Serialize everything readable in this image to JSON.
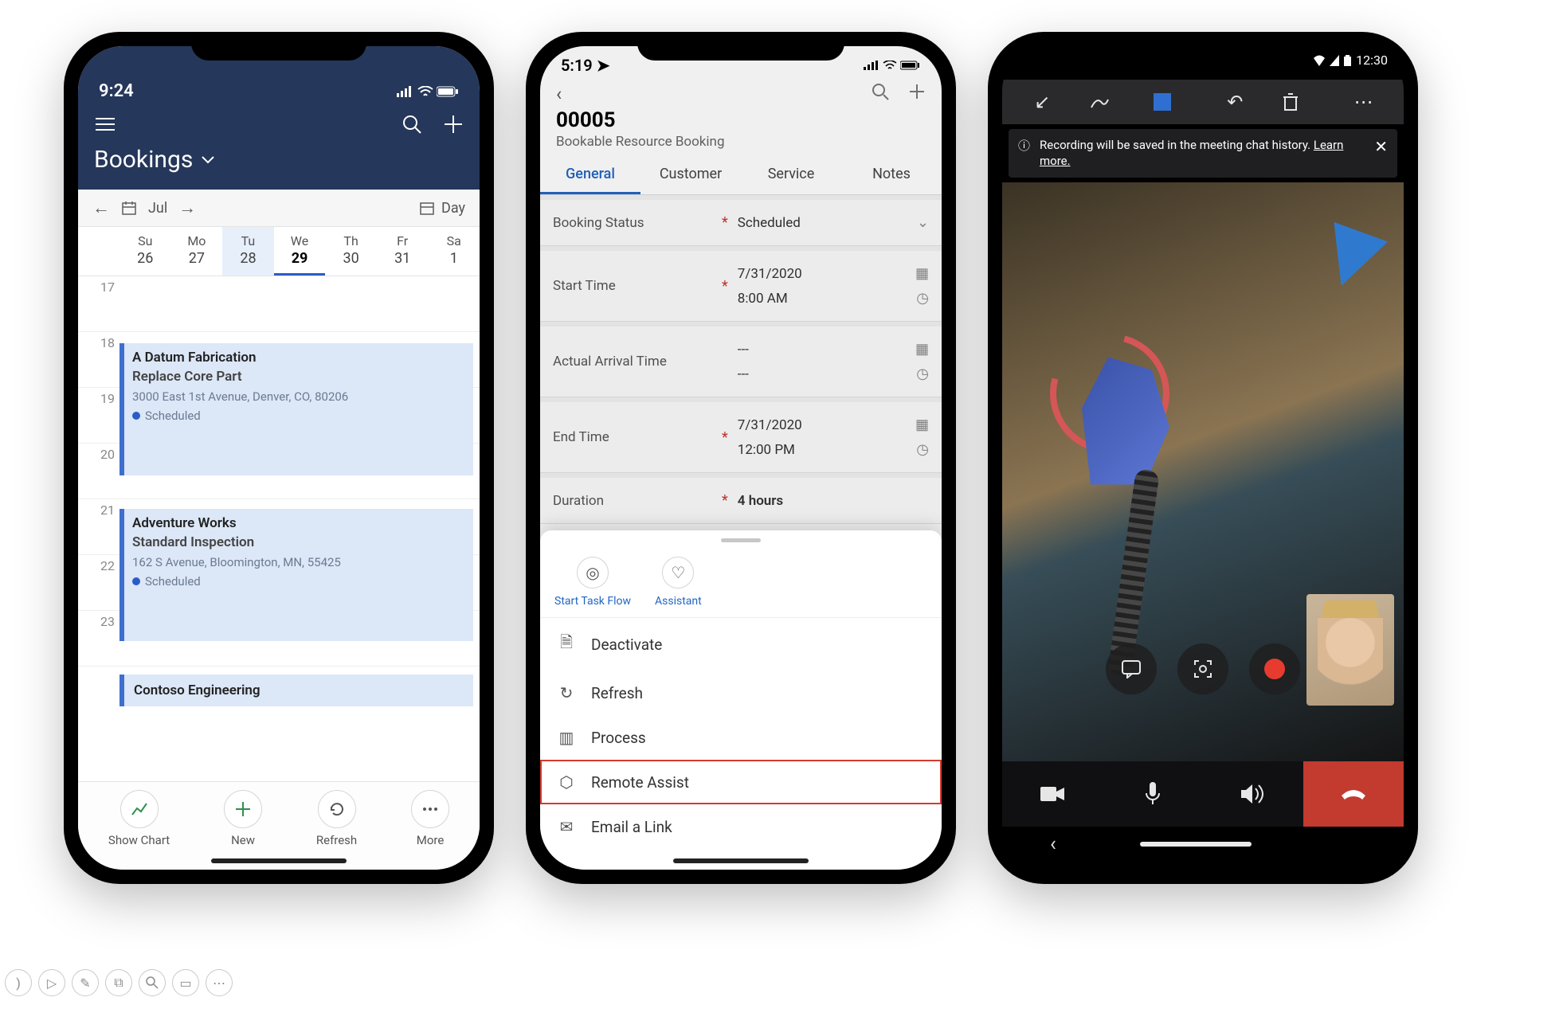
{
  "phone1": {
    "status_time": "9:24",
    "title": "Bookings",
    "nav_month": "Jul",
    "nav_mode": "Day",
    "days": [
      {
        "name": "Su",
        "num": "26"
      },
      {
        "name": "Mo",
        "num": "27"
      },
      {
        "name": "Tu",
        "num": "28"
      },
      {
        "name": "We",
        "num": "29"
      },
      {
        "name": "Th",
        "num": "30"
      },
      {
        "name": "Fr",
        "num": "31"
      },
      {
        "name": "Sa",
        "num": "1"
      }
    ],
    "hours": [
      "17",
      "18",
      "19",
      "20",
      "21",
      "22",
      "23"
    ],
    "events": [
      {
        "title": "A Datum Fabrication",
        "sub": "Replace Core Part",
        "addr": "3000 East 1st Avenue, Denver, CO, 80206",
        "status": "Scheduled"
      },
      {
        "title": "Adventure Works",
        "sub": "Standard Inspection",
        "addr": "162 S Avenue, Bloomington, MN, 55425",
        "status": "Scheduled"
      },
      {
        "title": "Contoso Engineering"
      }
    ],
    "bottom": {
      "chart": "Show Chart",
      "new": "New",
      "refresh": "Refresh",
      "more": "More"
    }
  },
  "phone2": {
    "status_time": "5:19",
    "record_id": "00005",
    "entity": "Bookable Resource Booking",
    "tabs": {
      "general": "General",
      "customer": "Customer",
      "service": "Service",
      "notes": "Notes"
    },
    "fields": {
      "status_label": "Booking Status",
      "status_value": "Scheduled",
      "start_label": "Start Time",
      "start_date": "7/31/2020",
      "start_time": "8:00 AM",
      "arrival_label": "Actual Arrival Time",
      "arrival_date": "---",
      "arrival_time": "---",
      "end_label": "End Time",
      "end_date": "7/31/2020",
      "end_time": "12:00 PM",
      "duration_label": "Duration",
      "duration_value": "4 hours"
    },
    "sheet_top": {
      "taskflow": "Start Task Flow",
      "assistant": "Assistant"
    },
    "sheet_items": {
      "deactivate": "Deactivate",
      "refresh": "Refresh",
      "process": "Process",
      "remote": "Remote Assist",
      "email": "Email a Link"
    }
  },
  "phone3": {
    "status_time": "12:30",
    "banner_text": "Recording will be saved in the meeting chat history.",
    "banner_link": "Learn more."
  }
}
